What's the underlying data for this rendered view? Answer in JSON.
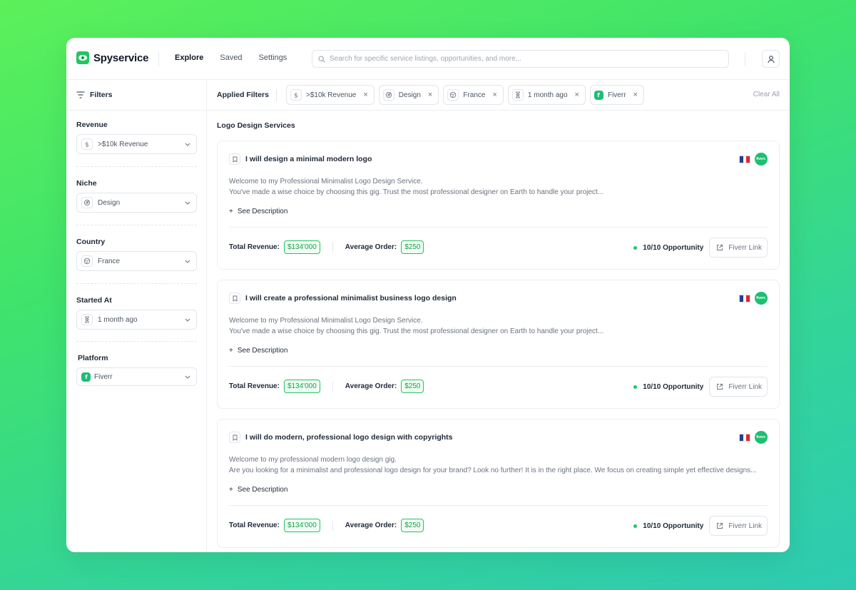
{
  "app": {
    "name": "Spyservice"
  },
  "nav": [
    {
      "label": "Explore",
      "active": true
    },
    {
      "label": "Saved",
      "active": false
    },
    {
      "label": "Settings",
      "active": false
    }
  ],
  "search": {
    "placeholder": "Search for specific service listings, opportunities, and more..."
  },
  "sidebar": {
    "title": "Filters",
    "groups": [
      {
        "label": "Revenue",
        "value": ">$10k Revenue",
        "icon": "dollar-icon"
      },
      {
        "label": "Niche",
        "value": "Design",
        "icon": "design-icon"
      },
      {
        "label": "Country",
        "value": "France",
        "icon": "globe-icon"
      },
      {
        "label": "Started At",
        "value": "1 month ago",
        "icon": "hourglass-icon"
      },
      {
        "label": "Platform",
        "value": "Fiverr",
        "icon": "fiverr-icon"
      }
    ]
  },
  "applied": {
    "label": "Applied Filters",
    "chips": [
      {
        "label": ">$10k Revenue",
        "icon": "dollar-icon"
      },
      {
        "label": "Design",
        "icon": "design-icon"
      },
      {
        "label": "France",
        "icon": "globe-icon"
      },
      {
        "label": "1 month ago",
        "icon": "hourglass-icon"
      },
      {
        "label": "Fiverr",
        "icon": "fiverr-icon"
      }
    ],
    "clear_label": "Clear All"
  },
  "section_title": "Logo Design Services",
  "labels": {
    "see_description": "See Description",
    "total_revenue": "Total Revenue:",
    "average_order": "Average Order:",
    "fiverr_link": "Fiverr Link",
    "fiverr_badge": "fiverr."
  },
  "colors": {
    "accent": "#22c55e",
    "fiverr": "#1dbf73"
  },
  "cards": [
    {
      "title": "I will design a minimal modern logo",
      "desc_line1": "Welcome to my Professional Minimalist Logo Design Service.",
      "desc_line2": "You've made a wise choice by choosing this gig. Trust the most professional designer on Earth to handle your project...",
      "total_revenue": "$134'000",
      "average_order": "$250",
      "opportunity": "10/10 Opportunity"
    },
    {
      "title": "I will create a professional minimalist business logo design",
      "desc_line1": "Welcome to my Professional Minimalist Logo Design Service.",
      "desc_line2": "You've made a wise choice by choosing this gig. Trust the most professional designer on Earth to handle your project...",
      "total_revenue": "$134'000",
      "average_order": "$250",
      "opportunity": "10/10 Opportunity"
    },
    {
      "title": "I will do modern, professional logo design with copyrights",
      "desc_line1": "Welcome to my professional modern logo design gig.",
      "desc_line2": "Are you looking for a minimalist and professional logo design for your brand? Look no further! It is in the right place. We focus on creating simple yet effective designs...",
      "total_revenue": "$134'000",
      "average_order": "$250",
      "opportunity": "10/10 Opportunity"
    }
  ]
}
